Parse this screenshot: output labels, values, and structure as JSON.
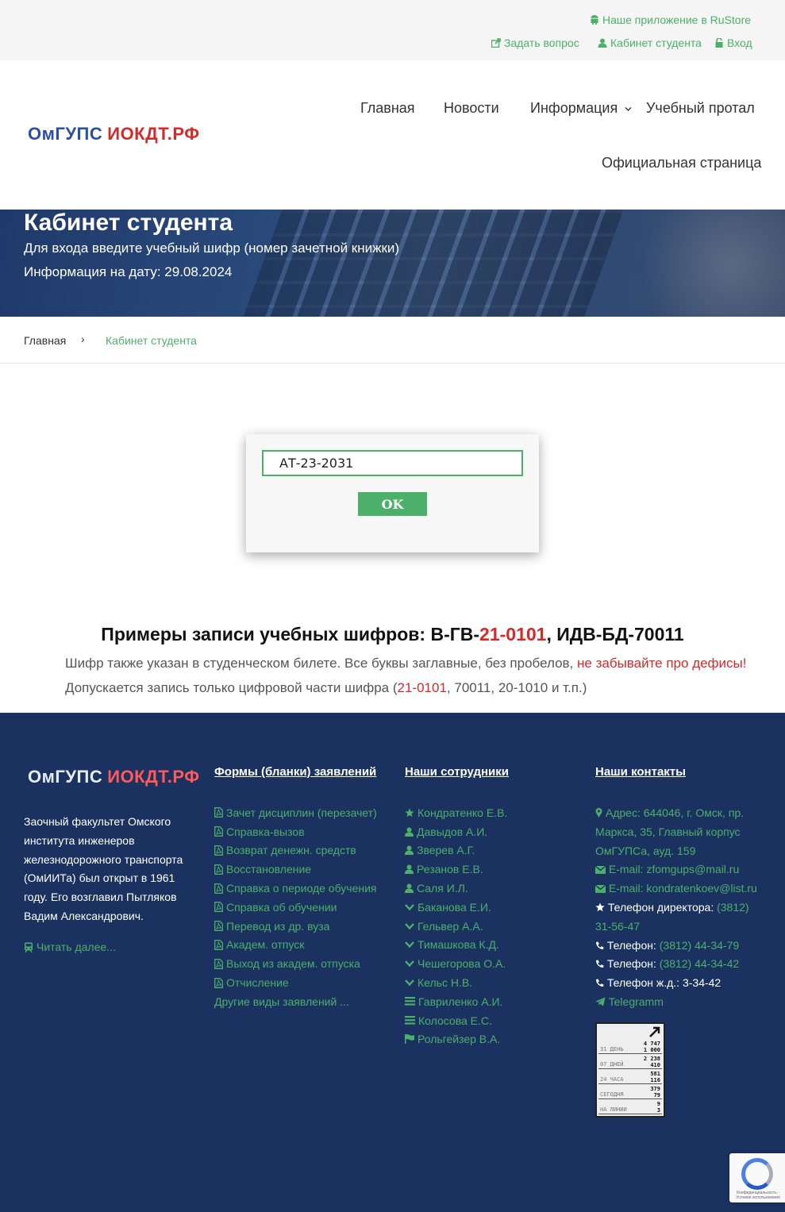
{
  "topbar": {
    "app_link": "Наше приложение в RuStore",
    "ask_link": "Задать вопрос",
    "cabinet_link": "Кабинет студента",
    "login_link": "Вход"
  },
  "logo": {
    "part1": "ОмГУПС",
    "part2": "ИОКДТ.РФ"
  },
  "nav": {
    "home": "Главная",
    "news": "Новости",
    "info": "Информация",
    "portal": "Учебный протал",
    "official": "Официальная страница"
  },
  "hero": {
    "title": "Кабинет студента",
    "line1": "Для входа введите учебный шифр (номер зачетной книжки)",
    "line2": "Информация на дату: 29.08.2024"
  },
  "breadcrumb": {
    "home": "Главная",
    "separator": "›",
    "current": "Кабинет студента"
  },
  "login": {
    "value": "АТ-23-2031",
    "button": "OK"
  },
  "examples": {
    "prefix": "Примеры записи учебных шифров: В-ГВ-",
    "red_part": "21-0101",
    "suffix": ", ИДВ-БД-70011"
  },
  "notes": {
    "line1_text": "Шифр также указан в студенческом билете. Все буквы заглавные, без пробелов, ",
    "line1_red": "не забывайте про дефисы!",
    "line2_pre": "Допускается запись только цифровой части шифра (",
    "line2_red": "21-0101",
    "line2_post": ", 70011, 20-1010 и т.п.)"
  },
  "footer": {
    "about": "Заочный факультет Омского института инженеров железнодорожного транспорта (ОмИИТа) был открыт в 1961 году. Его возглавил Пытляков Вадим Александрович.",
    "read_more": "Читать далее...",
    "forms_heading": "Формы (бланки) заявлений",
    "forms": [
      "Зачет дисциплин (перезачет)",
      "Справка-вызов",
      "Возврат денежн. средств",
      "Восстановление",
      "Справка о периоде обучения",
      "Справка об обучении",
      "Перевод из др. вуза",
      "Академ. отпуск",
      "Выход из академ. отпуска",
      "Отчисление"
    ],
    "forms_other": "Другие виды заявлений ...",
    "staff_heading": "Наши сотрудники",
    "staff": [
      {
        "name": "Кондратенко Е.В.",
        "icon": "star-icon"
      },
      {
        "name": "Давыдов А.И.",
        "icon": "user-icon"
      },
      {
        "name": "Зверев А.Г.",
        "icon": "user-icon"
      },
      {
        "name": "Резанов Е.В.",
        "icon": "user-icon"
      },
      {
        "name": "Саля И.Л.",
        "icon": "user-icon"
      },
      {
        "name": "Баканова Е.И.",
        "icon": "chevron-icon"
      },
      {
        "name": "Гельвер А.А.",
        "icon": "chevron-icon"
      },
      {
        "name": "Тимашкова К.Д.",
        "icon": "chevron-icon"
      },
      {
        "name": "Чешегорова О.А.",
        "icon": "chevron-icon"
      },
      {
        "name": "Кельс Н.В.",
        "icon": "chevron-icon"
      },
      {
        "name": "Гавриленко А.И.",
        "icon": "list-icon"
      },
      {
        "name": "Колосова Е.С.",
        "icon": "list-icon"
      },
      {
        "name": "Рольгейзер В.А.",
        "icon": "flag-icon"
      }
    ],
    "contacts_heading": "Наши контакты",
    "contacts": {
      "address": "Адрес: 644046, г. Омск, пр. Маркса, 35, Главный корпус ОмГУПСа, ауд. 159",
      "email1": "E-mail: zfomgups@mail.ru",
      "email2": "E-mail: kondratenkoev@list.ru",
      "director_label": "Телефон директора:",
      "director_phone": "(3812) 31-56-47",
      "phone1_label": "Телефон:",
      "phone1": "(3812) 44-34-79",
      "phone2_label": "Телефон:",
      "phone2": "(3812) 44-34-42",
      "rail_label": "Телефон ж.д.:",
      "rail": "3-34-42",
      "telegram": "Telegramm"
    },
    "counter": [
      {
        "label": "31 ДЕНЬ",
        "a": "4 747",
        "b": "1 000"
      },
      {
        "label": "07 ДНЕЙ",
        "a": "2 238",
        "b": "410"
      },
      {
        "label": "24 ЧАСА",
        "a": "581",
        "b": "116"
      },
      {
        "label": "СЕГОДНЯ",
        "a": "379",
        "b": "79"
      },
      {
        "label": "НА ЛИНИИ",
        "a": "9",
        "b": "3"
      }
    ],
    "recaptcha_text": "Конфиденциальность - Условия использования"
  },
  "colors": {
    "accent": "#4caf6a",
    "red": "#d42a2a",
    "footer": "#1b3260",
    "brand_blue": "#2c4f9e"
  }
}
